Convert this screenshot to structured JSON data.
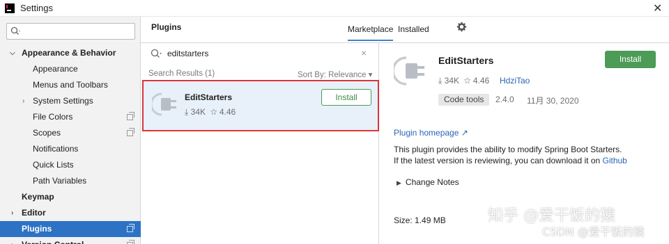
{
  "window": {
    "title": "Settings",
    "close_glyph": "✕"
  },
  "sidebar": {
    "search_placeholder": "",
    "items": [
      {
        "label": "Appearance & Behavior",
        "bold": true,
        "arrow": "expanded"
      },
      {
        "label": "Appearance"
      },
      {
        "label": "Menus and Toolbars"
      },
      {
        "label": "System Settings",
        "arrow": "collapsed"
      },
      {
        "label": "File Colors",
        "copy_icon": true
      },
      {
        "label": "Scopes",
        "copy_icon": true
      },
      {
        "label": "Notifications"
      },
      {
        "label": "Quick Lists"
      },
      {
        "label": "Path Variables"
      },
      {
        "label": "Keymap",
        "bold": true
      },
      {
        "label": "Editor",
        "bold": true,
        "arrow": "collapsed"
      },
      {
        "label": "Plugins",
        "bold": true,
        "selected": true,
        "copy_icon": true
      },
      {
        "label": "Version Control",
        "bold": true,
        "arrow": "collapsed",
        "copy_icon": true
      }
    ]
  },
  "header": {
    "title": "Plugins",
    "tabs": [
      {
        "label": "Marketplace",
        "active": true
      },
      {
        "label": "Installed",
        "active": false
      }
    ],
    "gear_icon": "gear-icon"
  },
  "marketplace": {
    "search_value": "editstarters",
    "clear_glyph": "×",
    "results_label": "Search Results (1)",
    "sort_label": "Sort By: Relevance ▾",
    "result": {
      "name": "EditStarters",
      "downloads": "34K",
      "rating": "4.46",
      "install_label": "Install"
    }
  },
  "detail": {
    "name": "EditStarters",
    "install_label": "Install",
    "downloads": "34K",
    "rating": "4.46",
    "author": "HdziTao",
    "tag": "Code tools",
    "version": "2.4.0",
    "date": "11月 30, 2020",
    "homepage": "Plugin homepage ↗",
    "desc_line1": "This plugin provides the ability to modify Spring Boot Starters.",
    "desc_line2": "If the latest version is reviewing, you can download it on ",
    "desc_link": "Github",
    "change_notes": "Change Notes",
    "size": "Size: 1.49 MB"
  },
  "watermark": {
    "line1": "知乎 @爱干饭的猿",
    "line2": "CSDN @爱干饭的猿"
  },
  "colors": {
    "selection": "#2d72c4",
    "install_green": "#4c9b56",
    "link": "#2a65b3",
    "highlight_border": "#d9353a"
  }
}
